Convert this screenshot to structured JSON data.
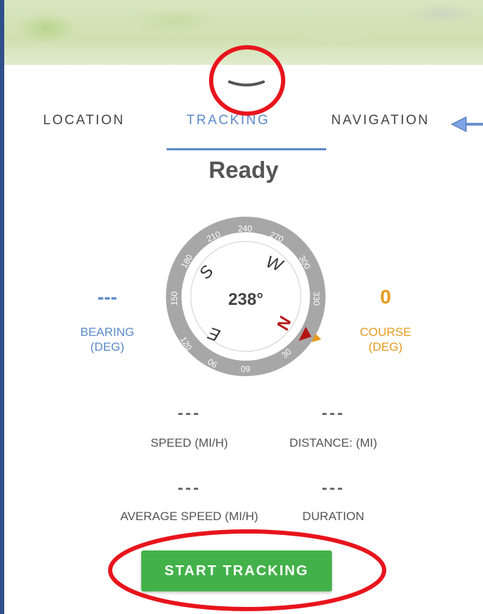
{
  "tabs": [
    {
      "label": "LOCATION"
    },
    {
      "label": "TRACKING"
    },
    {
      "label": "NAVIGATION"
    }
  ],
  "active_tab": "TRACKING",
  "status": "Ready",
  "compass": {
    "heading": "238°",
    "ring_labels": [
      "210",
      "240",
      "270",
      "300",
      "330",
      "30",
      "09",
      "06",
      "120",
      "150",
      "180"
    ],
    "cardinals": [
      "W",
      "S",
      "E",
      "N"
    ]
  },
  "bearing": {
    "value": "---",
    "label_line1": "BEARING",
    "label_line2": "(DEG)"
  },
  "course": {
    "value": "0",
    "label_line1": "COURSE",
    "label_line2": "(DEG)"
  },
  "stats": {
    "speed": {
      "value": "---",
      "label": "SPEED (MI/H)"
    },
    "distance": {
      "value": "---",
      "label": "DISTANCE: (MI)"
    },
    "avg_speed": {
      "value": "---",
      "label": "AVERAGE SPEED (MI/H)"
    },
    "duration": {
      "value": "---",
      "label": "DURATION"
    }
  },
  "start_button": "START TRACKING",
  "colors": {
    "accent_blue": "#5b8ac9",
    "course_orange": "#e59b1c",
    "button_green": "#43b14a",
    "annotation_red": "#e8141c"
  },
  "icons": [
    "collapse-chevron-icon",
    "pointer-arrow-icon",
    "compass-dial-icon"
  ]
}
